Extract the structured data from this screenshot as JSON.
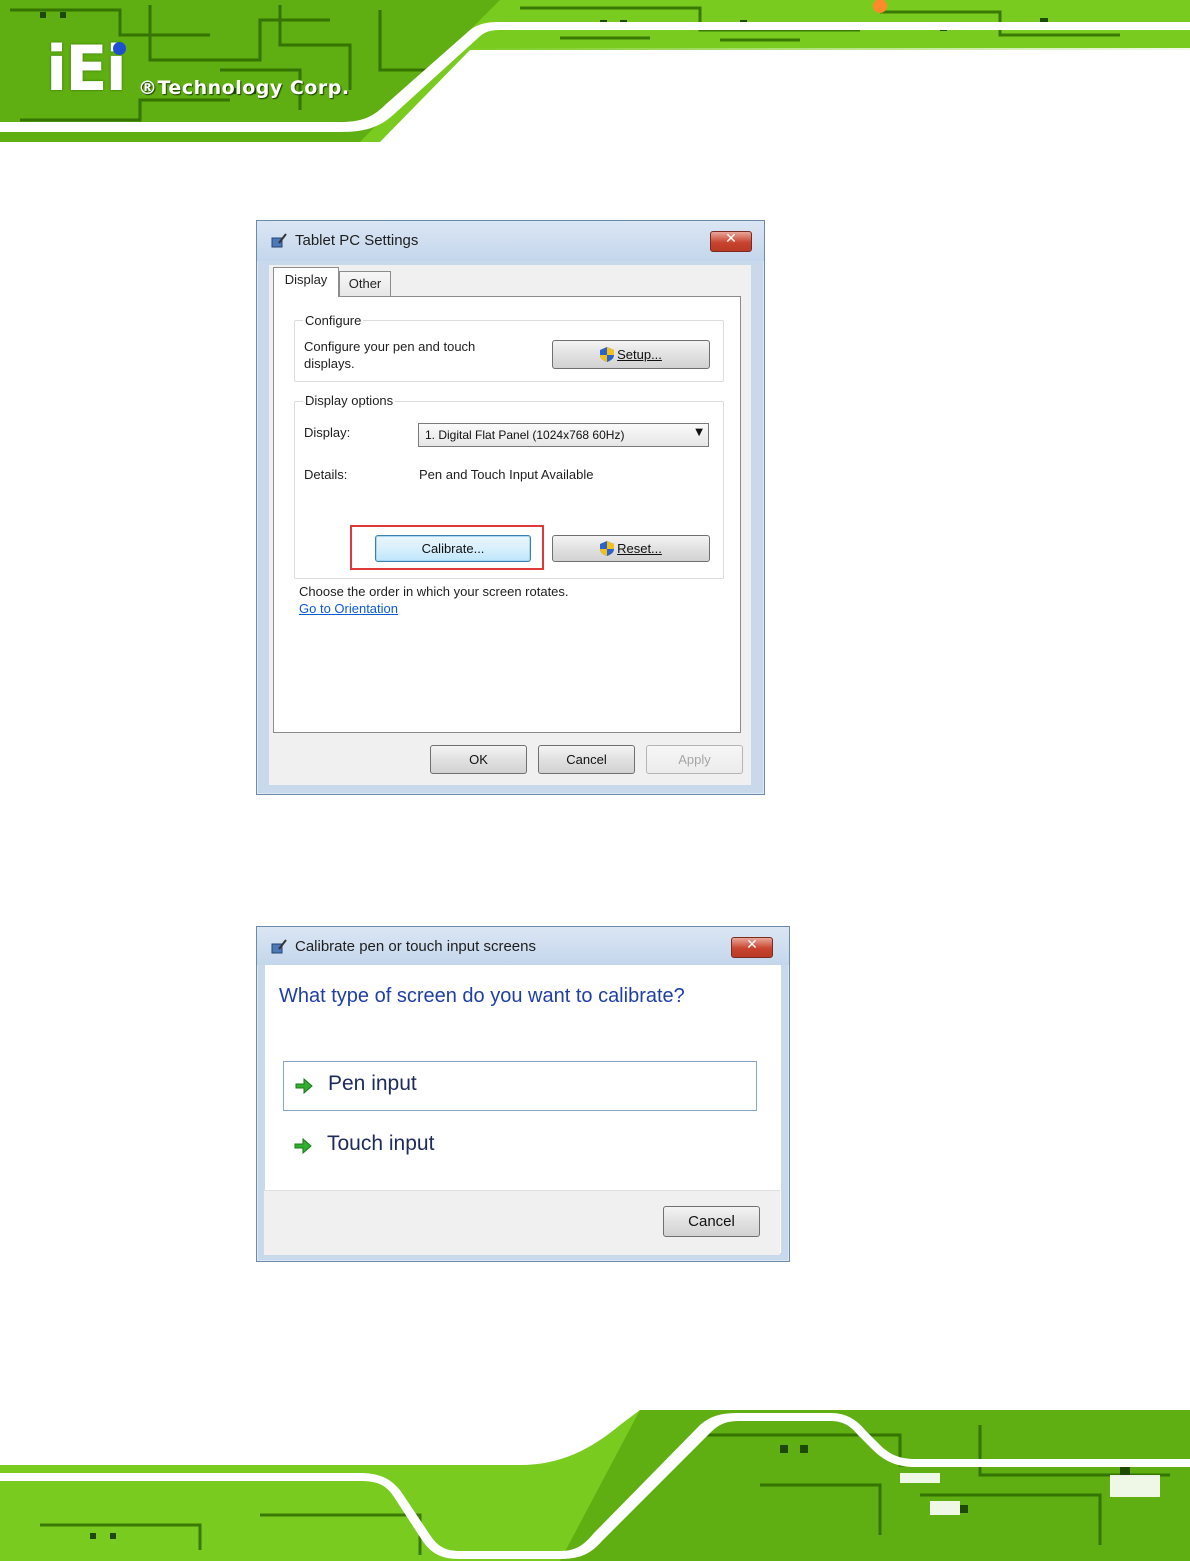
{
  "header": {
    "logo_mark": "iEi",
    "logo_text": "®Technology Corp."
  },
  "tablet_dialog": {
    "title": "Tablet PC Settings",
    "close_label": "✕",
    "tabs": [
      {
        "label": "Display",
        "active": true
      },
      {
        "label": "Other",
        "active": false
      }
    ],
    "configure": {
      "group_title": "Configure",
      "description": "Configure your pen and touch\ndisplays.",
      "setup_button": "Setup..."
    },
    "display_options": {
      "group_title": "Display options",
      "display_label": "Display:",
      "display_value": "1. Digital Flat Panel (1024x768 60Hz)",
      "details_label": "Details:",
      "details_value": "Pen and Touch Input Available",
      "calibrate_button": "Calibrate...",
      "reset_button": "Reset..."
    },
    "orientation_text": "Choose the order in which your screen rotates.",
    "orientation_link": "Go to Orientation",
    "buttons": {
      "ok": "OK",
      "cancel": "Cancel",
      "apply": "Apply"
    }
  },
  "calibrate_dialog": {
    "title": "Calibrate pen or touch input screens",
    "close_label": "✕",
    "question": "What type of screen do you want to calibrate?",
    "options": [
      {
        "label": "Pen input",
        "selected": true
      },
      {
        "label": "Touch input",
        "selected": false
      }
    ],
    "cancel_button": "Cancel"
  },
  "colors": {
    "circuit_green": "#7ed321",
    "circuit_dark": "#2f6b00",
    "link_blue": "#0b5bd6",
    "heading_blue": "#1f3fa8",
    "highlight_red": "#e0393b"
  }
}
